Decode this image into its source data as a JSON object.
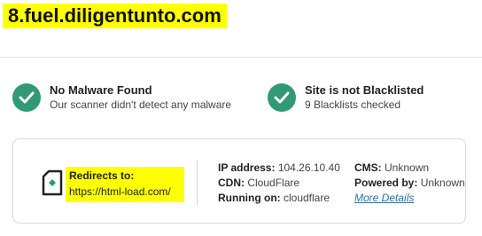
{
  "banner": {
    "domain": "8.fuel.diligentunto.com"
  },
  "status": {
    "malware": {
      "title": "No Malware Found",
      "subtitle": "Our scanner didn't detect any malware"
    },
    "blacklist": {
      "title": "Site is not Blacklisted",
      "subtitle": "9 Blacklists checked"
    }
  },
  "details": {
    "redirect_label": "Redirects to:",
    "redirect_url": "https://html-load.com/",
    "ip_label": "IP address:",
    "ip_value": "104.26.10.40",
    "cdn_label": "CDN:",
    "cdn_value": "CloudFlare",
    "running_label": "Running on:",
    "running_value": "cloudflare",
    "cms_label": "CMS:",
    "cms_value": "Unknown",
    "powered_label": "Powered by:",
    "powered_value": "Unknown",
    "more_link": "More Details"
  },
  "colors": {
    "check_green": "#2f9a74",
    "highlight": "#ffff00",
    "link": "#2e6f9e"
  }
}
